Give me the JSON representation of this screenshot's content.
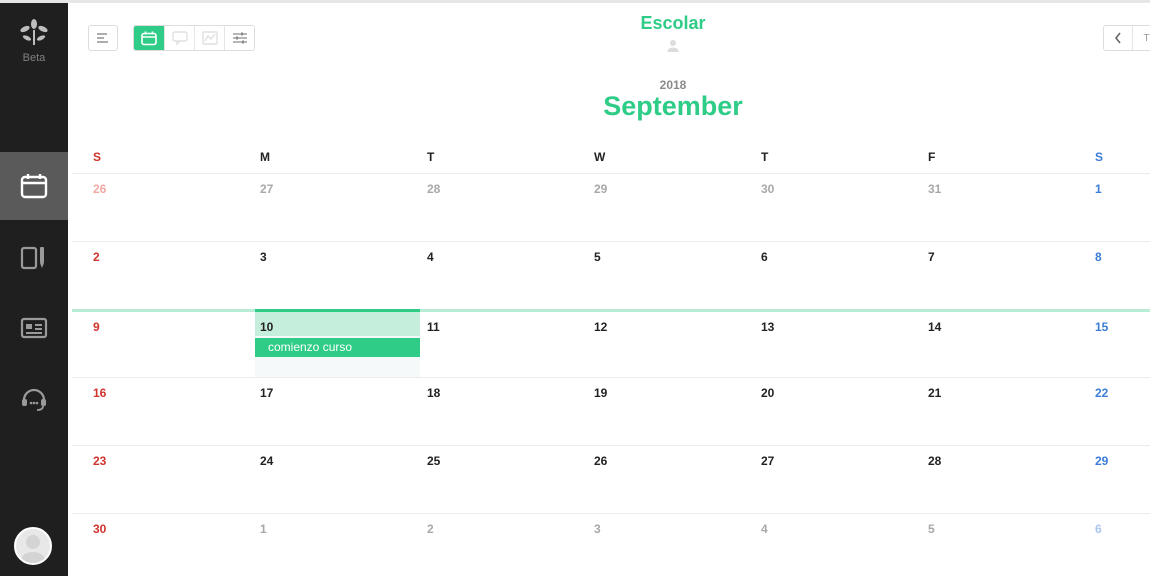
{
  "sidebar": {
    "brand_label": "Beta",
    "items": [
      {
        "icon": "calendar-icon",
        "active": true
      },
      {
        "icon": "tasks-icon",
        "active": false
      },
      {
        "icon": "board-icon",
        "active": false
      },
      {
        "icon": "headset-icon",
        "active": false
      }
    ]
  },
  "header": {
    "title": "Escolar",
    "views": [
      "calendar-icon",
      "chat-icon",
      "chart-icon",
      "sliders-icon"
    ],
    "next_label": "T"
  },
  "calendar": {
    "year": "2018",
    "month": "September",
    "weekdays": [
      "S",
      "M",
      "T",
      "W",
      "T",
      "F",
      "S"
    ],
    "weeks": [
      [
        "26",
        "27",
        "28",
        "29",
        "30",
        "31",
        "1"
      ],
      [
        "2",
        "3",
        "4",
        "5",
        "6",
        "7",
        "8"
      ],
      [
        "9",
        "10",
        "11",
        "12",
        "13",
        "14",
        "15"
      ],
      [
        "16",
        "17",
        "18",
        "19",
        "20",
        "21",
        "22"
      ],
      [
        "23",
        "24",
        "25",
        "26",
        "27",
        "28",
        "29"
      ],
      [
        "30",
        "1",
        "2",
        "3",
        "4",
        "5",
        "6"
      ]
    ],
    "event": {
      "label": "comienzo curso",
      "day": "10"
    },
    "colors": {
      "accent": "#2ecc87",
      "sunday": "#d0342c",
      "saturday": "#3b7dd8"
    }
  }
}
